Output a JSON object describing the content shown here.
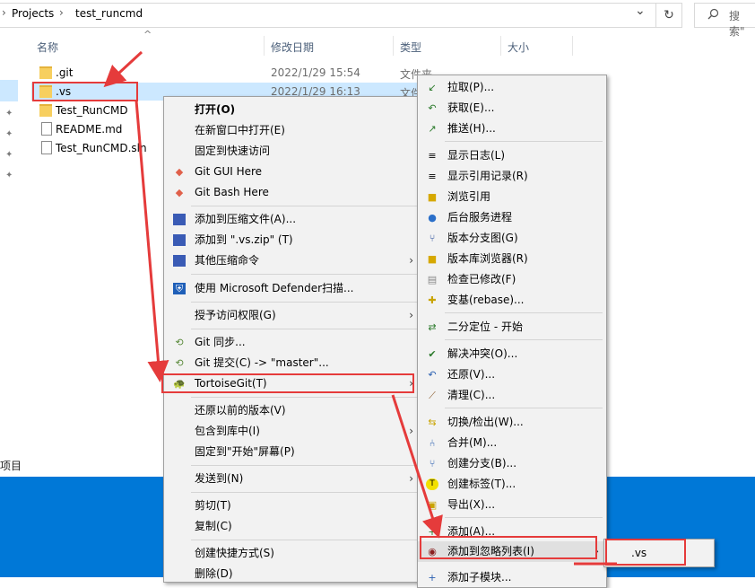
{
  "address": {
    "crumbs": [
      "Projects",
      "test_runcmd"
    ],
    "separator": "›",
    "dropdown_glyph": "⌄",
    "refresh_glyph": "↻",
    "search_placeholder": "搜索\""
  },
  "nav": {
    "project_label": "项目",
    "pin_glyph": "📌"
  },
  "columns": {
    "name": "名称",
    "date": "修改日期",
    "type": "类型",
    "size": "大小",
    "sort_glyph": "^"
  },
  "files": [
    {
      "name": ".git",
      "date": "2022/1/29 15:54",
      "type": "文件夹",
      "icon": "folder-icon"
    },
    {
      "name": ".vs",
      "date": "2022/1/29 16:13",
      "type": "文件夹",
      "icon": "folder-icon"
    },
    {
      "name": "Test_RunCMD",
      "date": "",
      "type": "",
      "icon": "folder-icon"
    },
    {
      "name": "README.md",
      "date": "",
      "type": "",
      "icon": "file-icon"
    },
    {
      "name": "Test_RunCMD.sln",
      "date": "",
      "type": "",
      "icon": "file-icon"
    }
  ],
  "context_menu": {
    "open": "打开(O)",
    "open_new_window": "在新窗口中打开(E)",
    "pin_quick_access": "固定到快速访问",
    "git_gui": "Git GUI Here",
    "git_bash": "Git Bash Here",
    "add_archive": "添加到压缩文件(A)...",
    "add_zip": "添加到 \".vs.zip\" (T)",
    "other_compress": "其他压缩命令",
    "defender": "使用 Microsoft Defender扫描...",
    "grant_access": "授予访问权限(G)",
    "git_sync": "Git 同步...",
    "git_commit": "Git 提交(C) -> \"master\"...",
    "tortoisegit": "TortoiseGit(T)",
    "restore_prev": "还原以前的版本(V)",
    "include_library": "包含到库中(I)",
    "pin_start": "固定到\"开始\"屏幕(P)",
    "send_to": "发送到(N)",
    "cut": "剪切(T)",
    "copy": "复制(C)",
    "create_shortcut": "创建快捷方式(S)",
    "delete": "删除(D)"
  },
  "tgit_menu": {
    "pull": "拉取(P)...",
    "fetch": "获取(E)...",
    "push": "推送(H)...",
    "show_log": "显示日志(L)",
    "show_reflog": "显示引用记录(R)",
    "browse_refs": "浏览引用",
    "daemon": "后台服务进程",
    "revision_graph": "版本分支图(G)",
    "repo_browser": "版本库浏览器(R)",
    "check_mods": "检查已修改(F)",
    "rebase": "变基(rebase)...",
    "bisect": "二分定位 - 开始",
    "resolve": "解决冲突(O)...",
    "revert": "还原(V)...",
    "cleanup": "清理(C)...",
    "switch": "切换/检出(W)...",
    "merge": "合并(M)...",
    "branch": "创建分支(B)...",
    "tag": "创建标签(T)...",
    "export": "导出(X)...",
    "add": "添加(A)...",
    "ignore": "添加到忽略列表(I)",
    "submodule": "添加子模块..."
  },
  "ignore_submenu": {
    "item": ".vs"
  },
  "colors": {
    "selection": "#cce8ff",
    "annotation_red": "#e53b3b",
    "desktop_blue": "#0078d7"
  }
}
